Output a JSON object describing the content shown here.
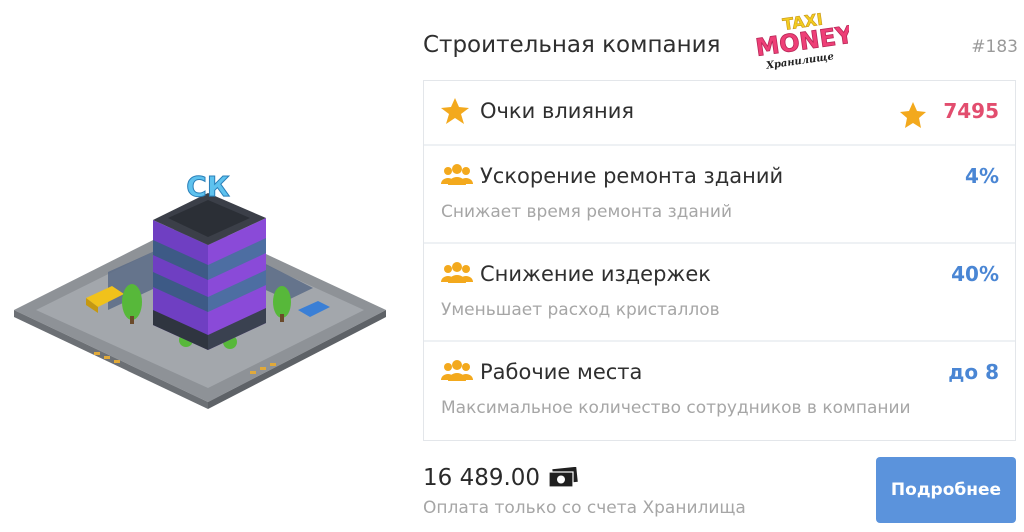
{
  "header": {
    "title": "Строительная компания",
    "logo_text": {
      "top": "TAXI",
      "middle": "MONEY",
      "bottom": "Хранилище"
    },
    "item_number": "#183"
  },
  "building": {
    "sign": "СК"
  },
  "stats": [
    {
      "icon": "star-icon",
      "title": "Очки влияния",
      "value": "7495",
      "value_icon": "star-icon",
      "value_color": "#e24d6e"
    },
    {
      "icon": "users-icon",
      "title": "Ускорение ремонта зданий",
      "value": "4%",
      "description": "Снижает время ремонта зданий",
      "value_color": "#4a86d4"
    },
    {
      "icon": "users-icon",
      "title": "Снижение издержек",
      "value": "40%",
      "description": "Уменьшает расход кристаллов",
      "value_color": "#4a86d4"
    },
    {
      "icon": "users-icon",
      "title": "Рабочие места",
      "value": "до 8",
      "description": "Максимальное количество сотрудников в компании",
      "value_color": "#4a86d4"
    }
  ],
  "footer": {
    "price": "16 489.00",
    "price_icon": "banknote-icon",
    "payment_note": "Оплата только со счета Хранилища",
    "details_label": "Подробнее"
  },
  "colors": {
    "accent_blue": "#5b93dc",
    "value_blue": "#4a86d4",
    "value_pink": "#e24d6e",
    "icon_orange": "#f3a91d",
    "muted_text": "#a6a6a6",
    "building_purple": "#8a4ad8"
  }
}
